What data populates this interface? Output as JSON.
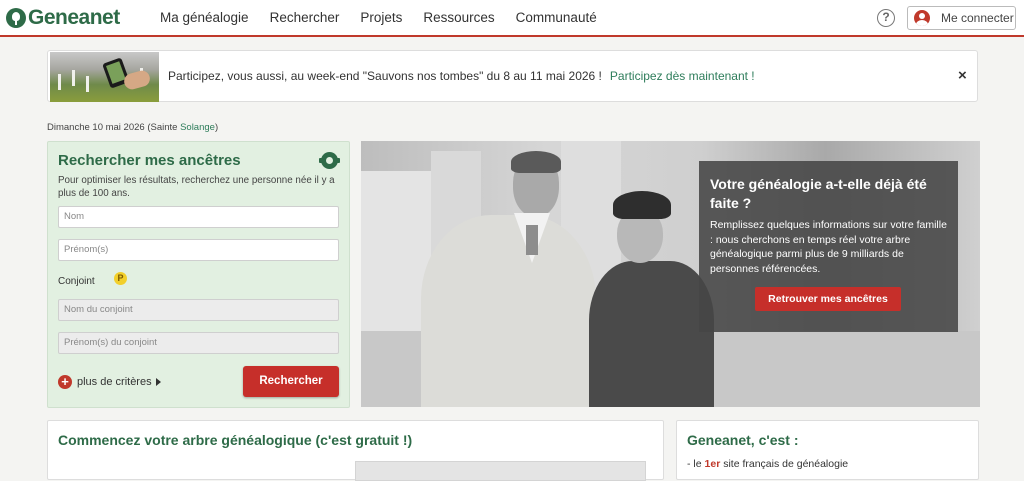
{
  "header": {
    "logo": "Geneanet",
    "nav": [
      "Ma généalogie",
      "Rechercher",
      "Projets",
      "Ressources",
      "Communauté"
    ],
    "help_icon": "?",
    "login_label": "Me connecter"
  },
  "banner": {
    "text": "Participez, vous aussi, au week-end \"Sauvons nos tombes\" du 8 au 11 mai 2026 !",
    "link": "Participez dès maintenant !",
    "close": "×"
  },
  "date_line": {
    "prefix": "Dimanche 10 mai 2026 (Sainte ",
    "saint": "Solange",
    "suffix": ")"
  },
  "search_panel": {
    "title": "Rechercher mes ancêtres",
    "description": "Pour optimiser les résultats, recherchez une personne née il y a plus de 100 ans.",
    "name_placeholder": "Nom",
    "firstname_placeholder": "Prénom(s)",
    "spouse_label": "Conjoint",
    "premium_badge": "P",
    "spouse_name_placeholder": "Nom du conjoint",
    "spouse_firstname_placeholder": "Prénom(s) du conjoint",
    "more_criteria": "plus de critères",
    "search_button": "Rechercher"
  },
  "hero": {
    "title": "Votre généalogie a-t-elle déjà été faite ?",
    "text": "Remplissez quelques informations sur votre famille : nous cherchons en temps réel votre arbre généalogique parmi plus de 9 milliards de personnes référencées.",
    "button": "Retrouver mes ancêtres"
  },
  "panel_left": {
    "title": "Commencez votre arbre généalogique (c'est gratuit !)"
  },
  "panel_right": {
    "title": "Geneanet, c'est :",
    "line_prefix": "- le ",
    "line_highlight": "1er",
    "line_suffix": " site français de généalogie"
  },
  "colors": {
    "brand_green": "#2e6b48",
    "accent_red": "#c62f2a",
    "link_green": "#2e7d5b",
    "panel_green": "#e2f0e1"
  }
}
